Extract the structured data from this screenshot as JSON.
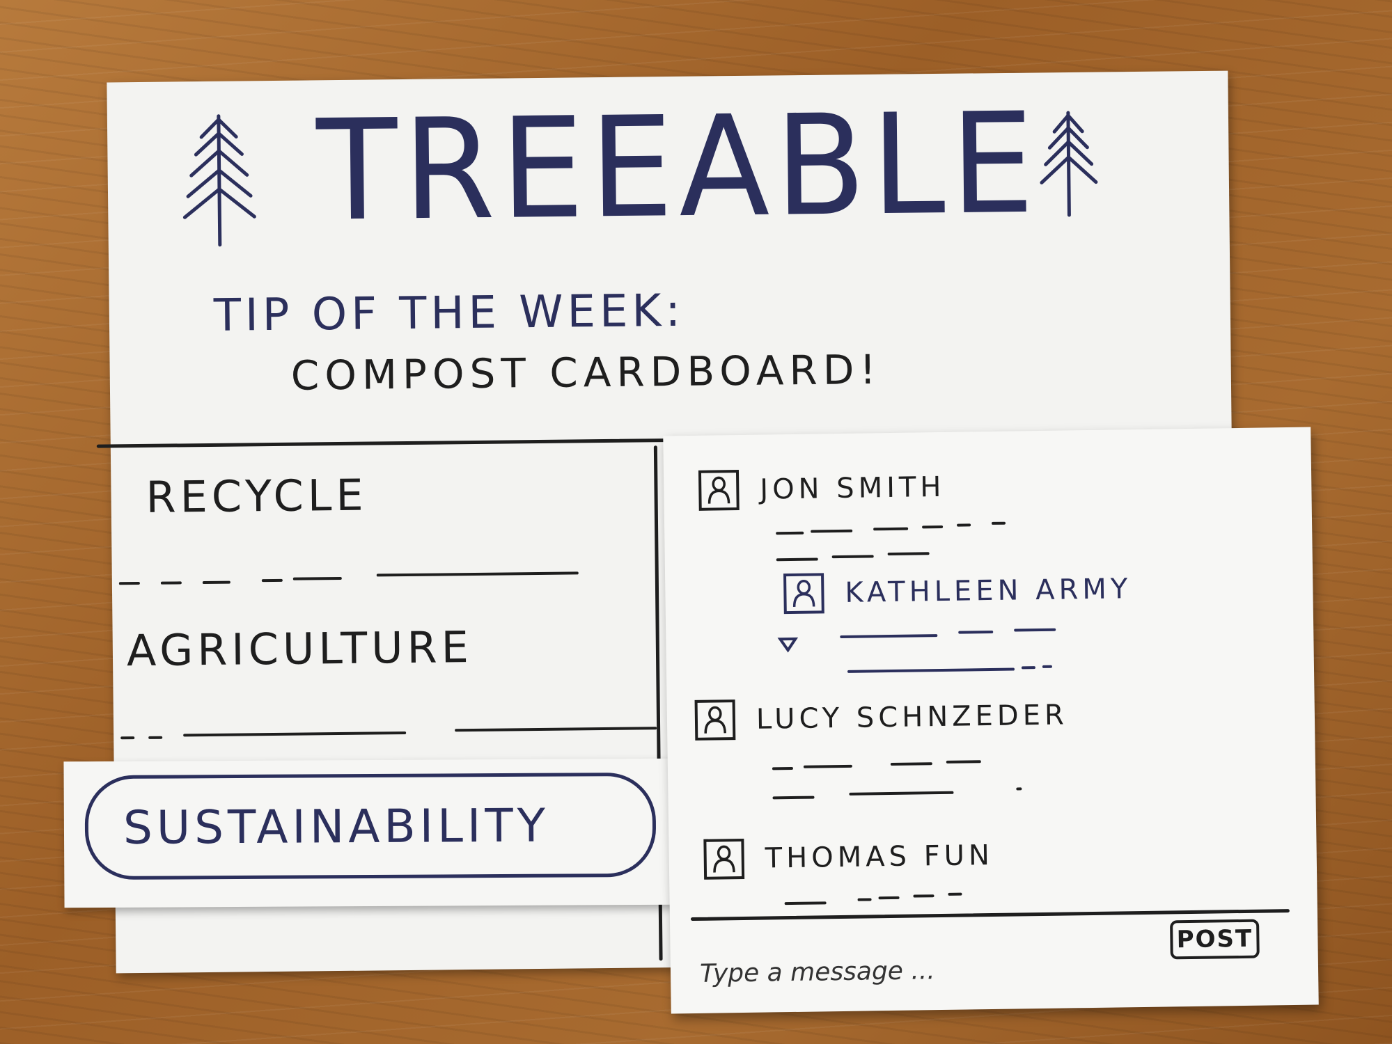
{
  "app": {
    "title": "TREEABLE"
  },
  "tip": {
    "label": "TIP OF THE WEEK:",
    "text": "COMPOST CARDBOARD!"
  },
  "categories": [
    {
      "label": "RECYCLE"
    },
    {
      "label": "AGRICULTURE"
    },
    {
      "label": "SUSTAINABILITY",
      "selected": true
    }
  ],
  "chat": {
    "messages": [
      {
        "user": "JON SMITH",
        "avatar_icon": "user-avatar-icon"
      },
      {
        "user": "KATHLEEN ARMY",
        "avatar_icon": "user-avatar-icon",
        "reply": true
      },
      {
        "user": "LUCY SCHNZEDER",
        "avatar_icon": "user-avatar-icon"
      },
      {
        "user": "THOMAS FUN",
        "avatar_icon": "user-avatar-icon"
      }
    ],
    "input_placeholder": "Type a message ...",
    "post_label": "POST"
  },
  "colors": {
    "ink_blue": "#2b2f5c",
    "ink_black": "#1e1e1e",
    "paper": "#f3f3f1"
  }
}
